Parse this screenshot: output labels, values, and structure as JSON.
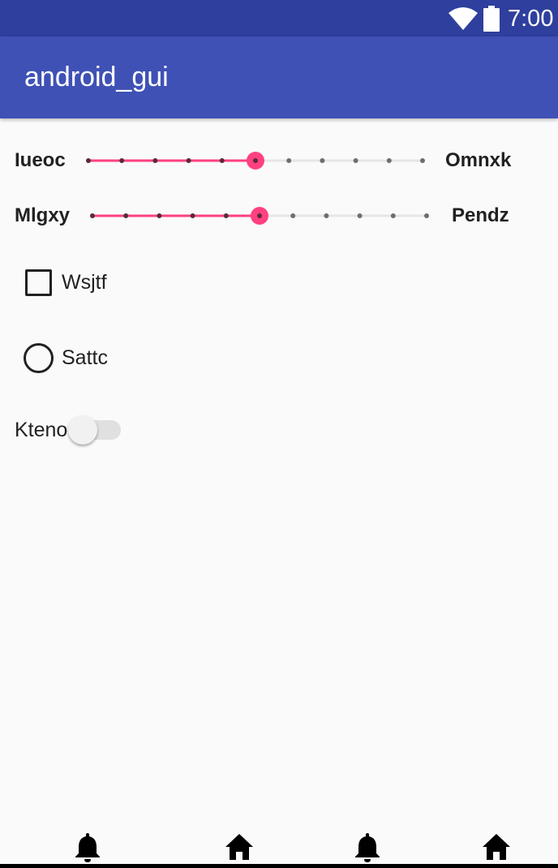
{
  "status_bar": {
    "time": "7:00",
    "icons": [
      "wifi-icon",
      "battery-icon"
    ]
  },
  "app_bar": {
    "title": "android_gui"
  },
  "sliders": [
    {
      "left_label": "Iueoc",
      "right_label": "Omnxk",
      "steps": 10,
      "value": 5,
      "accent": "#ff4081"
    },
    {
      "left_label": "Mlgxy",
      "right_label": "Pendz",
      "steps": 10,
      "value": 5,
      "accent": "#ff4081"
    }
  ],
  "checkbox": {
    "label": "Wsjtf",
    "checked": false
  },
  "radio": {
    "label": "Sattc",
    "selected": false
  },
  "switch": {
    "label": "Kteno",
    "on": false
  },
  "bottom_nav": {
    "items": [
      "bell-icon",
      "home-icon",
      "bell-icon",
      "home-icon"
    ]
  },
  "colors": {
    "status_bar": "#2f3f9e",
    "app_bar": "#3f51b5",
    "accent": "#ff4081",
    "background": "#fafafa"
  }
}
